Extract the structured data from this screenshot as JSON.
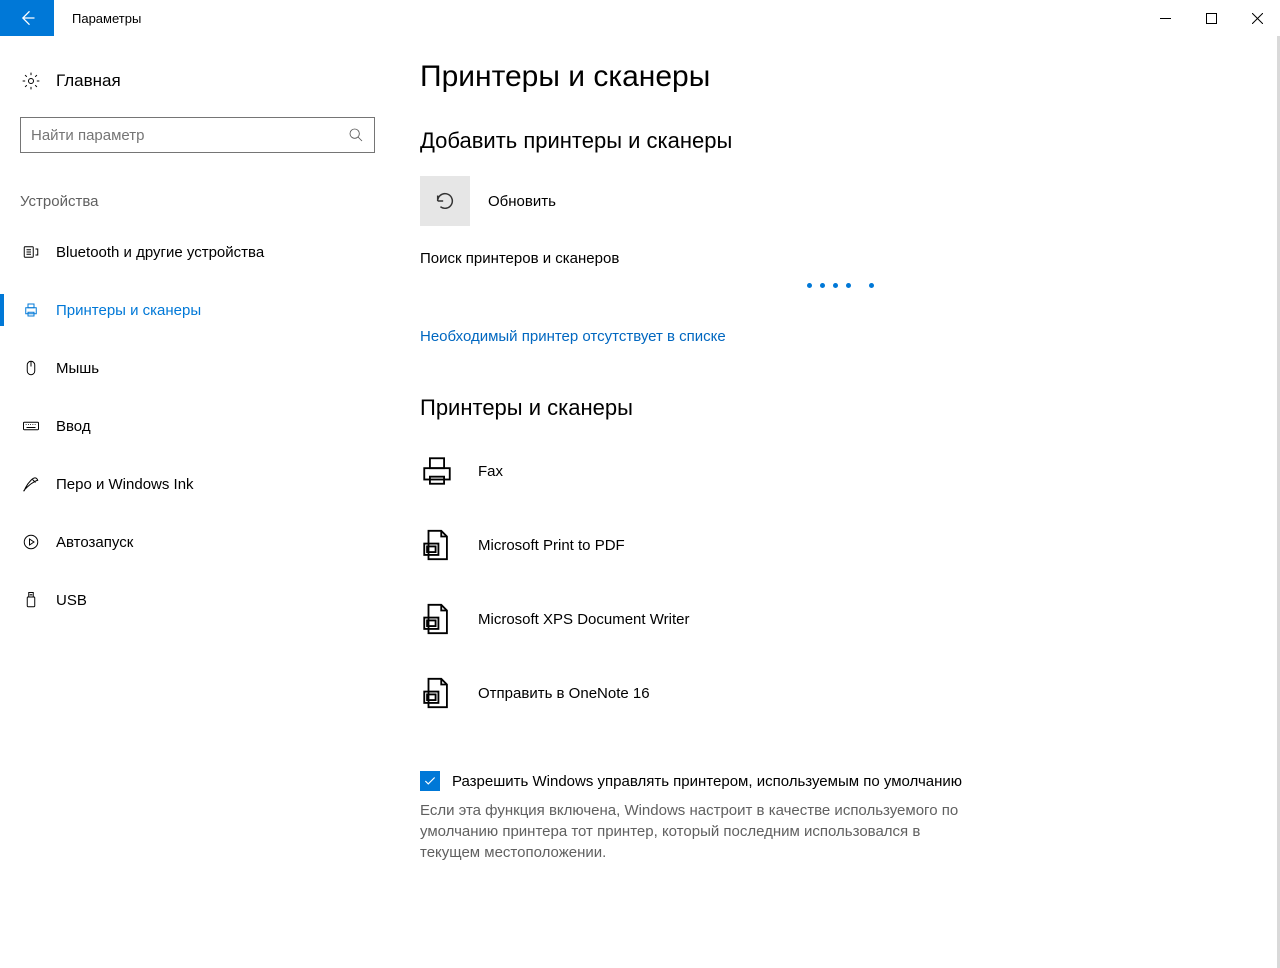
{
  "window": {
    "title": "Параметры"
  },
  "sidebar": {
    "home": "Главная",
    "search_placeholder": "Найти параметр",
    "group_label": "Устройства",
    "items": [
      {
        "label": "Bluetooth и другие устройства",
        "icon": "bluetooth"
      },
      {
        "label": "Принтеры и сканеры",
        "icon": "printer",
        "active": true
      },
      {
        "label": "Мышь",
        "icon": "mouse"
      },
      {
        "label": "Ввод",
        "icon": "keyboard"
      },
      {
        "label": "Перо и Windows Ink",
        "icon": "pen"
      },
      {
        "label": "Автозапуск",
        "icon": "autoplay"
      },
      {
        "label": "USB",
        "icon": "usb"
      }
    ]
  },
  "main": {
    "page_title": "Принтеры и сканеры",
    "add_section_title": "Добавить принтеры и сканеры",
    "refresh_label": "Обновить",
    "searching_text": "Поиск принтеров и сканеров",
    "not_listed_link": "Необходимый принтер отсутствует в списке",
    "list_section_title": "Принтеры и сканеры",
    "printers": [
      {
        "label": "Fax",
        "icon": "fax"
      },
      {
        "label": "Microsoft Print to PDF",
        "icon": "pdf-printer"
      },
      {
        "label": "Microsoft XPS Document Writer",
        "icon": "pdf-printer"
      },
      {
        "label": "Отправить в OneNote 16",
        "icon": "pdf-printer"
      }
    ],
    "default_checkbox_label": "Разрешить Windows управлять принтером, используемым по умолчанию",
    "default_checkbox_checked": true,
    "default_hint": "Если эта функция включена, Windows настроит в качестве используемого по умолчанию принтера тот принтер, который последним использовался в текущем местоположении."
  }
}
